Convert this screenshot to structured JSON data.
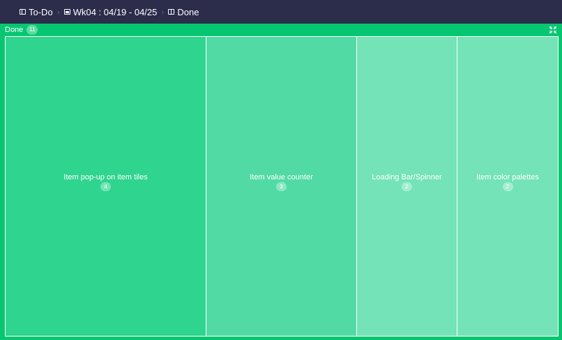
{
  "breadcrumb": [
    {
      "icon": "kanban-icon",
      "label": "To-Do"
    },
    {
      "icon": "image-icon",
      "label": "Wk04 : 04/19 - 04/25"
    },
    {
      "icon": "board-icon",
      "label": "Done"
    }
  ],
  "panel": {
    "title": "Done",
    "count": "11"
  },
  "tiles": [
    {
      "label": "Item pop-up on item tiles",
      "count": "4",
      "color": "#2fd48e"
    },
    {
      "label": "Item value counter",
      "count": "3",
      "color": "#52daa5"
    },
    {
      "label": "Loading Bar/Spinner",
      "count": "2",
      "color": "#74e3b8"
    },
    {
      "label": "Item color palettes",
      "count": "2",
      "color": "#74e3b8"
    }
  ],
  "colors": {
    "topbar": "#2b2d4b",
    "panel": "#07c672"
  }
}
